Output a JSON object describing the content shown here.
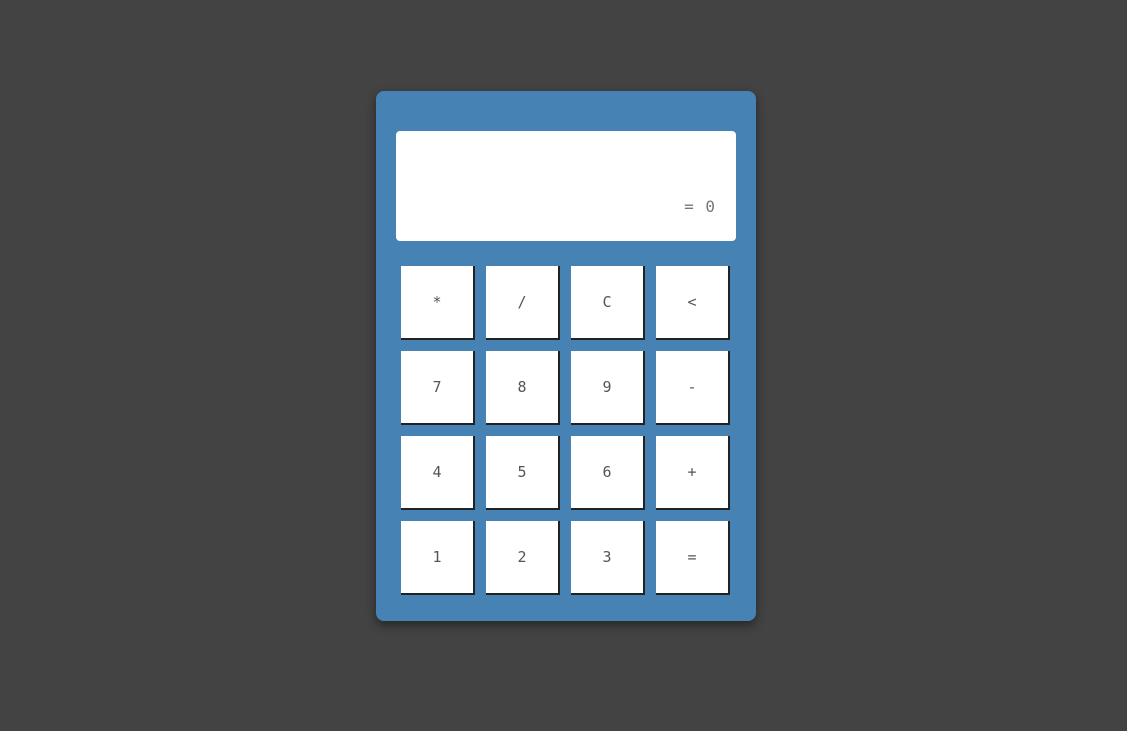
{
  "display": {
    "expression": "",
    "result": "= 0"
  },
  "keys": [
    {
      "label": "*",
      "name": "multiply-key"
    },
    {
      "label": "/",
      "name": "divide-key"
    },
    {
      "label": "C",
      "name": "clear-key"
    },
    {
      "label": "<",
      "name": "backspace-key"
    },
    {
      "label": "7",
      "name": "digit-7-key"
    },
    {
      "label": "8",
      "name": "digit-8-key"
    },
    {
      "label": "9",
      "name": "digit-9-key"
    },
    {
      "label": "-",
      "name": "subtract-key"
    },
    {
      "label": "4",
      "name": "digit-4-key"
    },
    {
      "label": "5",
      "name": "digit-5-key"
    },
    {
      "label": "6",
      "name": "digit-6-key"
    },
    {
      "label": "+",
      "name": "add-key"
    },
    {
      "label": "1",
      "name": "digit-1-key"
    },
    {
      "label": "2",
      "name": "digit-2-key"
    },
    {
      "label": "3",
      "name": "digit-3-key"
    },
    {
      "label": "=",
      "name": "equals-key"
    }
  ],
  "colors": {
    "page_background": "#434343",
    "calculator_body": "#4682b4",
    "key_background": "#ffffff",
    "display_background": "#ffffff"
  }
}
